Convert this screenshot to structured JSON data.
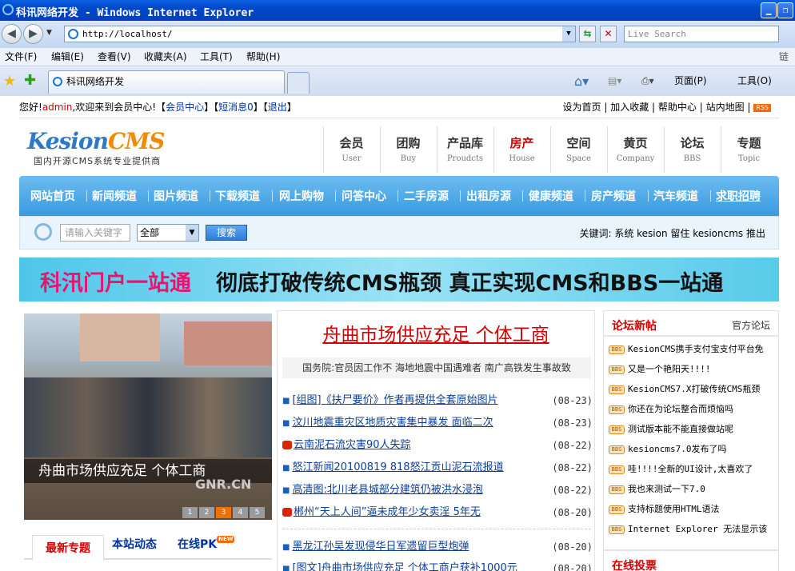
{
  "window": {
    "title": "科讯网络开发 - Windows Internet Explorer"
  },
  "address": {
    "url": "http://localhost/",
    "search_placeholder": "Live Search"
  },
  "menu": [
    "文件(F)",
    "编辑(E)",
    "查看(V)",
    "收藏夹(A)",
    "工具(T)",
    "帮助(H)"
  ],
  "menu_right": "链接",
  "tab": {
    "label": "科讯网络开发"
  },
  "commands": {
    "page": "页面(P)",
    "tools": "工具(O)"
  },
  "site": {
    "welcome_pre": "您好!",
    "user": "admin",
    "welcome_mid": ",欢迎来到会员中心!【",
    "member_center": "会员中心",
    "sep1": "】【",
    "sms": "短消息0",
    "sep2": "】【",
    "logout": "退出",
    "sep3": "】",
    "top_links": [
      "设为首页",
      "加入收藏",
      "帮助中心",
      "站内地图"
    ],
    "rss": "RSS",
    "logo_main": "Kesion",
    "logo_cms": "CMS",
    "logo_slogan": "国内开源CMS系统专业提供商"
  },
  "channels": [
    {
      "cn": "会员",
      "en": "User"
    },
    {
      "cn": "团购",
      "en": "Buy"
    },
    {
      "cn": "产品库",
      "en": "Proudcts"
    },
    {
      "cn": "房产",
      "en": "House"
    },
    {
      "cn": "空间",
      "en": "Space"
    },
    {
      "cn": "黄页",
      "en": "Company"
    },
    {
      "cn": "论坛",
      "en": "BBS"
    },
    {
      "cn": "专题",
      "en": "Topic"
    }
  ],
  "nav": [
    "网站首页",
    "新闻频道",
    "图片频道",
    "下载频道",
    "网上购物",
    "问答中心",
    "二手房源",
    "出租房源",
    "健康频道",
    "房产频道",
    "汽车频道",
    "求职招聘"
  ],
  "search": {
    "placeholder": "请输入关键字",
    "select": "全部",
    "button": "搜索",
    "hot_label": "关键词:",
    "hot_words": "系统 kesion 留住 kesioncms 推出"
  },
  "banner": {
    "part1": "科汛门户一站通",
    "part2": "彻底打破传统CMS瓶颈 真正实现CMS和BBS一站通"
  },
  "focus": {
    "caption": "舟曲市场供应充足 个体工商",
    "watermark": "GNR.CN",
    "pages": [
      "1",
      "2",
      "3",
      "4",
      "5"
    ]
  },
  "left_tabs": {
    "t1": "最新专题",
    "t2": "本站动态",
    "t3": "在线PK",
    "new": "NEW"
  },
  "headline": "舟曲市场供应充足 个体工商",
  "subline": "国务院:官员因工作不 海地地震中国遇难者 南广高铁发生事故致",
  "news": [
    {
      "title": "[组图]《扶尸要价》作者再提供全套原始图片",
      "date": "(08-23)"
    },
    {
      "title": "汶川地震重灾区地质灾害集中暴发 面临二次",
      "date": "(08-23)"
    },
    {
      "title": "云南泥石流灾害90人失踪",
      "date": "(08-22)"
    },
    {
      "title": "怒江新闻20100819 818怒江贡山泥石流报道",
      "date": "(08-22)"
    },
    {
      "title": "高清图:北川老县城部分建筑仍被洪水浸泡",
      "date": "(08-22)"
    },
    {
      "title": "郴州“天上人间”逼未成年少女卖淫 5年无",
      "date": "(08-20)"
    },
    {
      "title": "黑龙江孙吴发现侵华日军遗留巨型炮弹",
      "date": "(08-20)"
    },
    {
      "title": "[图文]舟曲市场供应充足 个体工商户获补1000元",
      "date": "(08-20)"
    }
  ],
  "forum": {
    "title": "论坛新帖",
    "official": "官方论坛",
    "items": [
      "KesionCMS携手支付宝支付平台免",
      "又是一个艳阳天!!!!",
      "KesionCMS7.X打破传统CMS瓶颈",
      "你还在为论坛整合而烦恼吗",
      "测试版本能不能直接做站呢",
      "kesioncms7.0发布了吗",
      "哇!!!!全新的UI设计,太喜欢了",
      "我也来测试一下7.0",
      "支持标题使用HTML语法",
      "Internet Explorer 无法显示该"
    ]
  },
  "vote": {
    "title": "在线投票"
  }
}
